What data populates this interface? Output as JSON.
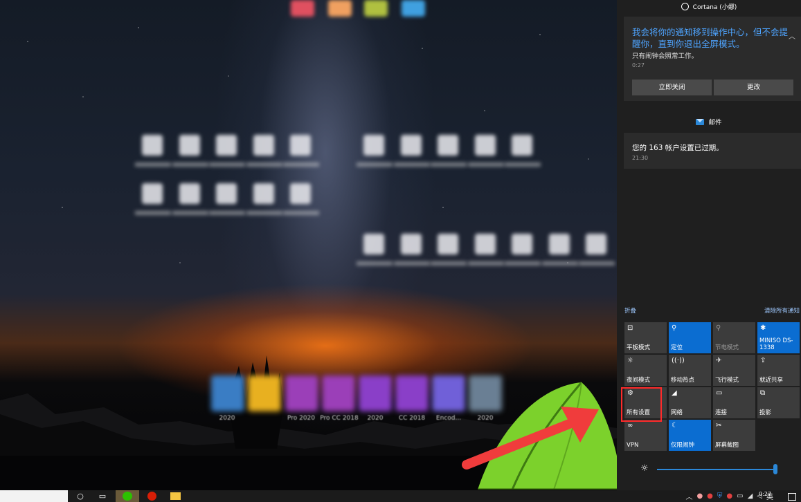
{
  "desktop": {
    "app_labels": [
      "2020",
      "Pro 2020",
      "Pro CC 2018",
      "2020",
      "CC 2018",
      "Encod...",
      "2020"
    ]
  },
  "action_center": {
    "header": "Cortana (小娜)",
    "notification1": {
      "message": "我会将你的通知移到操作中心，但不会提醒你，直到你退出全屏模式。",
      "sub": "只有闹钟会照常工作。",
      "time": "0:27",
      "btn_close": "立即关闭",
      "btn_change": "更改"
    },
    "mail": {
      "header": "邮件",
      "message": "您的 163 帐户设置已过期。",
      "time": "21:30"
    },
    "collapse": "折叠",
    "clear_all": "清除所有通知",
    "tiles": [
      {
        "label": "平板模式",
        "icon": "⊡",
        "state": "off"
      },
      {
        "label": "定位",
        "icon": "⚲",
        "state": "on"
      },
      {
        "label": "节电模式",
        "icon": "⚲",
        "state": "disabled"
      },
      {
        "label": "MINISO DS-1338",
        "icon": "✱",
        "state": "on"
      },
      {
        "label": "夜间模式",
        "icon": "☼",
        "state": "off"
      },
      {
        "label": "移动热点",
        "icon": "((·))",
        "state": "off"
      },
      {
        "label": "飞行模式",
        "icon": "✈",
        "state": "off"
      },
      {
        "label": "就近共享",
        "icon": "⇪",
        "state": "off"
      },
      {
        "label": "所有设置",
        "icon": "⚙",
        "state": "off"
      },
      {
        "label": "网络",
        "icon": "◢",
        "state": "off"
      },
      {
        "label": "连接",
        "icon": "▭",
        "state": "off"
      },
      {
        "label": "投影",
        "icon": "⧉",
        "state": "off"
      },
      {
        "label": "VPN",
        "icon": "∞",
        "state": "off"
      },
      {
        "label": "仅限闹钟",
        "icon": "☾",
        "state": "on"
      },
      {
        "label": "屏幕截图",
        "icon": "✂",
        "state": "off"
      }
    ],
    "brightness": 100
  },
  "taskbar": {
    "clock": "0:27",
    "ime": "英"
  },
  "colors": {
    "accent": "#0b6dd1",
    "highlight_box": "#ff2a2a",
    "arrow": "#f03c3c"
  }
}
